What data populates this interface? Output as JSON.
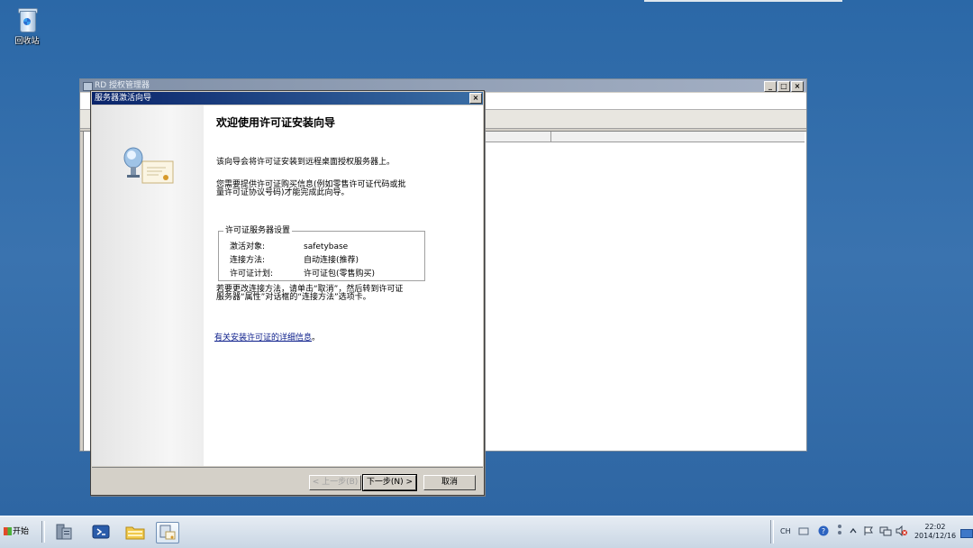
{
  "desktop": {
    "recycle_bin_label": "回收站"
  },
  "background_window": {
    "title": "RD 授权管理器"
  },
  "dialog": {
    "title": "服务器激活向导",
    "heading": "欢迎使用许可证安装向导",
    "intro": "该向导会将许可证安装到远程桌面授权服务器上。",
    "need_line1": "您需要提供许可证购买信息(例如零售许可证代码或批",
    "need_line2": "量许可证协议号码)才能完成此向导。",
    "settings": {
      "group_title": "许可证服务器设置",
      "rows": [
        {
          "key": "激活对象:",
          "value": "safetybase"
        },
        {
          "key": "连接方法:",
          "value": "自动连接(推荐)"
        },
        {
          "key": "许可证计划:",
          "value": "许可证包(零售购买)"
        }
      ]
    },
    "change_line1": "若要更改连接方法，请单击“取消”，然后转到许可证",
    "change_line2": "服务器“属性”对话框的“连接方法”选项卡。",
    "link_text": "有关安装许可证的详细信息",
    "link_suffix": "。",
    "buttons": {
      "back": "< 上一步(B)",
      "next": "下一步(N) >",
      "cancel": "取消"
    }
  },
  "taskbar": {
    "start_label": "开始",
    "tray": {
      "language": "CH"
    },
    "clock": {
      "time": "22:02",
      "date": "2014/12/16"
    }
  },
  "icons": [
    "recycle-bin-icon",
    "server-manager-icon",
    "powershell-icon",
    "file-explorer-icon",
    "rd-licensing-icon"
  ]
}
